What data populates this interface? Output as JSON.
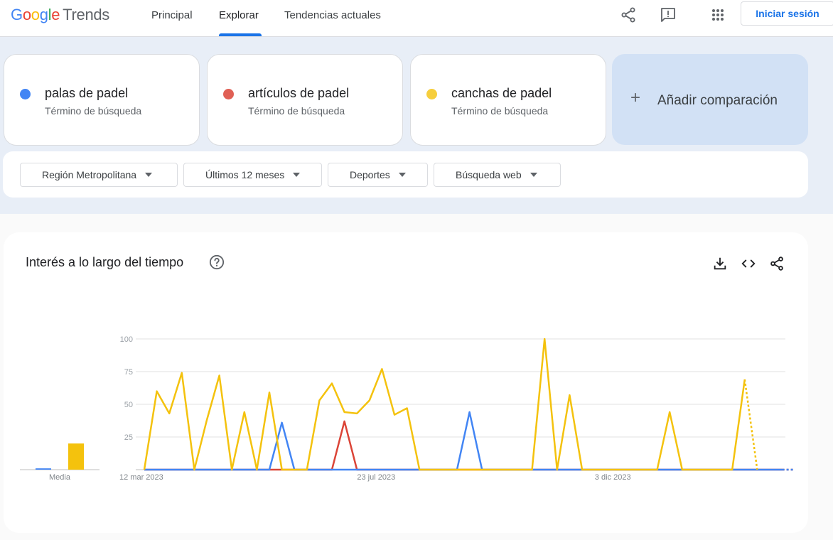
{
  "header": {
    "logo_google": "Google",
    "logo_trends": "Trends",
    "nav": [
      "Principal",
      "Explorar",
      "Tendencias actuales"
    ],
    "active_nav": "Explorar",
    "icons": [
      "share-icon",
      "feedback-icon",
      "apps-grid-icon"
    ],
    "signin_label": "Iniciar sesión"
  },
  "terms": [
    {
      "name": "palas de padel",
      "subtitle": "Término de búsqueda",
      "color": "#4285f4"
    },
    {
      "name": "artículos de padel",
      "subtitle": "Término de búsqueda",
      "color": "#db4437"
    },
    {
      "name": "canchas de padel",
      "subtitle": "Término de búsqueda",
      "color": "#f4c20d"
    }
  ],
  "add_comparison": {
    "label": "Añadir comparación",
    "icon": "plus-icon"
  },
  "filters": [
    "Región Metropolitana",
    "Últimos 12 meses",
    "Deportes",
    "Búsqueda web"
  ],
  "interest_card": {
    "title": "Interés a lo largo del tiempo",
    "icons": [
      "help-icon",
      "download-icon",
      "embed-code-icon",
      "share-icon"
    ]
  },
  "chart_data": {
    "type": "line",
    "title": "",
    "xlabel": "",
    "ylabel": "",
    "ylim": [
      0,
      100
    ],
    "yticks": [
      25,
      50,
      75,
      100
    ],
    "xtick_labels": [
      "12 mar 2023",
      "23 jul 2023",
      "3 dic 2023"
    ],
    "xtick_indices": [
      0,
      19,
      38
    ],
    "grid": true,
    "last_point_partial": true,
    "series": [
      {
        "name": "palas de padel",
        "color": "#4285f4",
        "values": [
          0,
          0,
          0,
          0,
          0,
          0,
          0,
          0,
          0,
          0,
          0,
          36,
          0,
          0,
          0,
          0,
          0,
          0,
          0,
          0,
          0,
          0,
          0,
          0,
          0,
          0,
          44,
          0,
          0,
          0,
          0,
          0,
          0,
          0,
          0,
          0,
          0,
          0,
          0,
          0,
          0,
          0,
          0,
          0,
          0,
          0,
          0,
          0,
          0,
          0,
          0,
          0,
          0
        ]
      },
      {
        "name": "artículos de padel",
        "color": "#db4437",
        "values": [
          0,
          0,
          0,
          0,
          0,
          0,
          0,
          0,
          0,
          0,
          0,
          0,
          0,
          0,
          0,
          0,
          37,
          0,
          0,
          0,
          0,
          0,
          0,
          0,
          0,
          0,
          0,
          0,
          0,
          0,
          0,
          0,
          0,
          0,
          0,
          0,
          0,
          0,
          0,
          0,
          0,
          0,
          0,
          0,
          0,
          0,
          0,
          0,
          0,
          0,
          0,
          0,
          0
        ]
      },
      {
        "name": "canchas de padel",
        "color": "#f4c20d",
        "values": [
          0,
          60,
          43,
          74,
          0,
          38,
          72,
          0,
          44,
          0,
          59,
          0,
          0,
          0,
          53,
          66,
          44,
          43,
          53,
          77,
          42,
          47,
          0,
          0,
          0,
          0,
          0,
          0,
          0,
          0,
          0,
          0,
          100,
          0,
          57,
          0,
          0,
          0,
          0,
          0,
          0,
          0,
          44,
          0,
          0,
          0,
          0,
          0,
          69,
          0
        ]
      }
    ],
    "average_bars": {
      "label": "Media",
      "values": [
        1,
        0,
        20
      ]
    }
  }
}
